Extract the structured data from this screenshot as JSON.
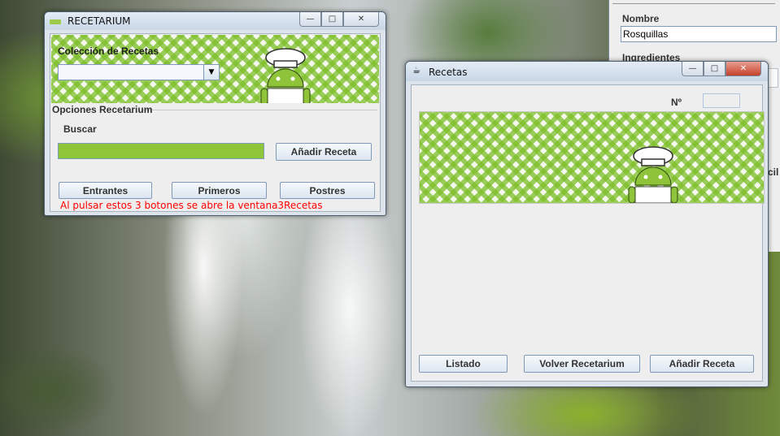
{
  "bg_window": {
    "nombre_label": "Nombre",
    "nombre_value": "Rosquillas",
    "ingredientes_label": "Ingredientes",
    "partial_text": "cil"
  },
  "recetarium_window": {
    "title": "RECETARIUM",
    "banner_label": "Colección de Recetas",
    "collection_selected": "",
    "section_title": "Opciones Recetarium",
    "search_label": "Buscar",
    "search_value": "",
    "add_recipe_button": "Añadir Receta",
    "buttons": [
      "Entrantes",
      "Primeros",
      "Postres"
    ],
    "note": "Al pulsar estos 3 botones se abre la ventana3Recetas"
  },
  "recetas_window": {
    "title": "Recetas",
    "number_label": "Nº",
    "number_value": "",
    "buttons": [
      "Listado",
      "Volver Recetarium",
      "Añadir Receta"
    ]
  },
  "colors": {
    "banner_green": "#7cbe28",
    "search_fill": "#8ec63a",
    "note_red": "#ff0000",
    "android_green": "#8fc33a"
  }
}
